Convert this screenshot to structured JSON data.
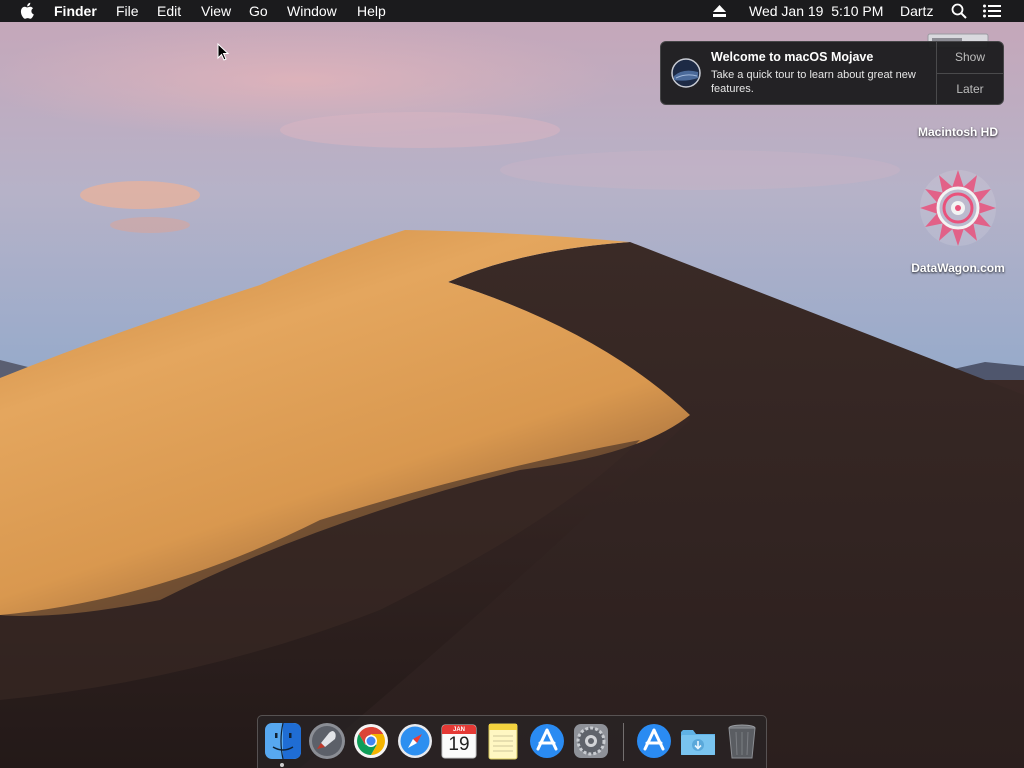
{
  "menubar": {
    "app_name": "Finder",
    "menus": [
      "File",
      "Edit",
      "View",
      "Go",
      "Window",
      "Help"
    ],
    "clock": "Wed Jan 19  5:10 PM",
    "user": "Dartz",
    "icons": [
      "apple-icon",
      "eject-icon",
      "spotlight-icon",
      "notification-center-icon"
    ]
  },
  "notification": {
    "title": "Welcome to macOS Mojave",
    "body": "Take a quick tour to learn about great new features.",
    "show_label": "Show",
    "later_label": "Later"
  },
  "desktop": {
    "items": [
      {
        "label": "Macintosh HD",
        "icon": "hard-drive-icon"
      },
      {
        "label": "DataWagon.com",
        "icon": "mandala-image-icon"
      }
    ]
  },
  "dock": {
    "apps": [
      {
        "name": "Finder",
        "icon": "finder-icon",
        "running": true
      },
      {
        "name": "Launchpad",
        "icon": "launchpad-icon",
        "running": false
      },
      {
        "name": "Google Chrome",
        "icon": "chrome-icon",
        "running": false
      },
      {
        "name": "Safari",
        "icon": "safari-icon",
        "running": false
      },
      {
        "name": "Calendar",
        "icon": "calendar-icon",
        "running": false,
        "month": "JAN",
        "day": "19"
      },
      {
        "name": "Notes",
        "icon": "notes-icon",
        "running": false
      },
      {
        "name": "App Store",
        "icon": "app-store-icon",
        "running": false
      },
      {
        "name": "System Preferences",
        "icon": "system-preferences-icon",
        "running": false
      }
    ],
    "others": [
      {
        "name": "Applications",
        "icon": "applications-stack-icon"
      },
      {
        "name": "Downloads",
        "icon": "downloads-folder-icon"
      },
      {
        "name": "Trash",
        "icon": "trash-icon"
      }
    ]
  },
  "colors": {
    "menubar_bg": "#1b1b1d",
    "sky_top": "#c9b3c4",
    "sky_bottom": "#8aa5c8",
    "dune_light": "#e0a158",
    "dune_shadow": "#2b1f1d"
  }
}
